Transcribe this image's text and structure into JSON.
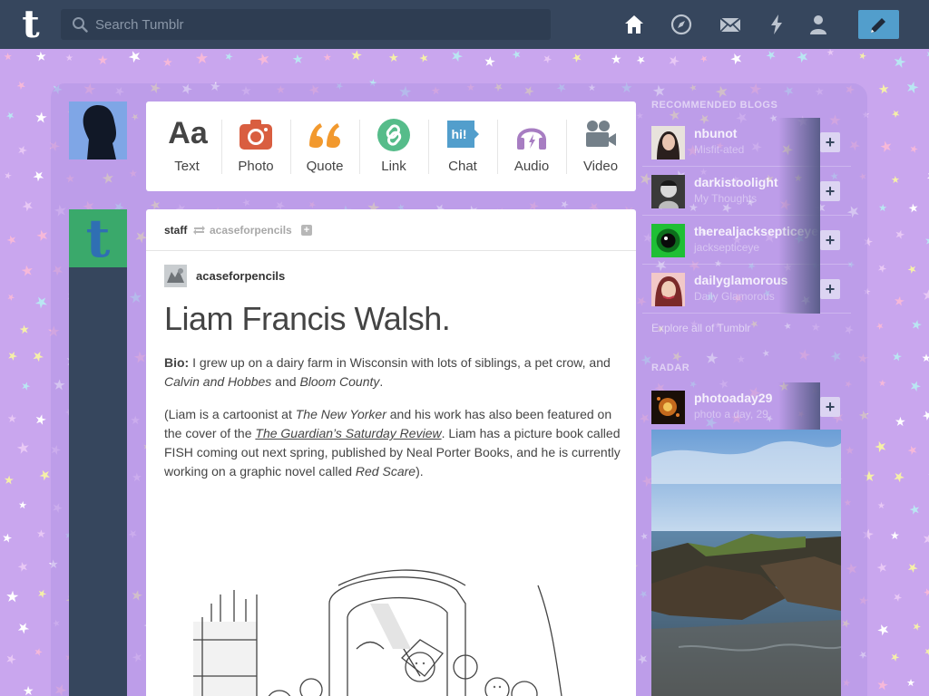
{
  "topbar": {
    "search_placeholder": "Search Tumblr",
    "nav_icons": [
      "home-icon",
      "explore-icon",
      "inbox-icon",
      "activity-icon",
      "account-icon"
    ],
    "compose_icon": "pencil-icon",
    "brand_color": "#36465d",
    "compose_color": "#529ecc"
  },
  "composer": {
    "types": [
      {
        "label": "Text",
        "icon": "text-icon",
        "color": "#444444"
      },
      {
        "label": "Photo",
        "icon": "camera-icon",
        "color": "#d95e40"
      },
      {
        "label": "Quote",
        "icon": "quote-icon",
        "color": "#f2992e"
      },
      {
        "label": "Link",
        "icon": "link-icon",
        "color": "#56bc8a"
      },
      {
        "label": "Chat",
        "icon": "chat-icon",
        "color": "#529ecc"
      },
      {
        "label": "Audio",
        "icon": "headphones-icon",
        "color": "#a77dc2"
      },
      {
        "label": "Video",
        "icon": "video-camera-icon",
        "color": "#748089"
      }
    ]
  },
  "post": {
    "author": "staff",
    "reblogged_from": "acaseforpencils",
    "source_name": "acaseforpencils",
    "title": "Liam Francis Walsh.",
    "bio_label": "Bio:",
    "bio_text_1": " I grew up on a dairy farm in Wisconsin with lots of siblings, a pet crow, and ",
    "bio_italic_1": "Calvin and Hobbes",
    "bio_and": " and ",
    "bio_italic_2": "Bloom County",
    "bio_end": ".",
    "p2_open": "(Liam is a cartoonist at ",
    "p2_italic_1": "The New Yorker",
    "p2_mid_1": " and his work has also been featured on the cover of the ",
    "p2_link": "The Guardian’s Saturday Review",
    "p2_mid_2": ". Liam has a picture book called FISH coming out next spring, published by Neal Porter Books, and he is currently working on a graphic novel called ",
    "p2_italic_2": "Red Scare",
    "p2_close": ")."
  },
  "sidebar": {
    "recommended_title": "RECOMMENDED BLOGS",
    "blogs": [
      {
        "name": "nbunot",
        "subtitle": "Misfit-ated"
      },
      {
        "name": "darkistoolight",
        "subtitle": "My Thoughts"
      },
      {
        "name": "therealjacksepticeye",
        "subtitle": "jacksepticeye"
      },
      {
        "name": "dailyglamorous",
        "subtitle": "Daily Glamorous"
      }
    ],
    "explore_link": "Explore all of Tumblr",
    "radar_title": "RADAR",
    "radar_blog": {
      "name": "photoaday29",
      "subtitle": "photo a day, 29"
    },
    "follow_label": "+"
  }
}
